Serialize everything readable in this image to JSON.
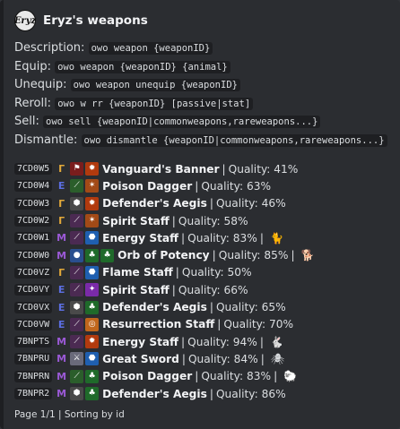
{
  "embed": {
    "author": "Eryz's weapons",
    "avatar_text": "Eryz",
    "commands": [
      {
        "label": "Description:",
        "code": "owo weapon {weaponID}"
      },
      {
        "label": "Equip:",
        "code": "owo weapon {weaponID} {animal}"
      },
      {
        "label": "Unequip:",
        "code": "owo weapon unequip {weaponID}"
      },
      {
        "label": "Reroll:",
        "code": "owo w rr {weaponID} [passive|stat]"
      },
      {
        "label": "Sell:",
        "code": "owo sell {weaponID|commonweapons,rareweapons...}"
      },
      {
        "label": "Dismantle:",
        "code": "owo dismantle {weaponID|commonweapons,rareweapons...}"
      }
    ],
    "weapons": [
      {
        "id": "7CD0W5",
        "rank": "common",
        "icons": [
          "banner",
          "fire"
        ],
        "name": "Vanguard's Banner",
        "quality": "Quality: 41%",
        "pet": ""
      },
      {
        "id": "7CD0W4",
        "rank": "uncommon",
        "icons": [
          "dagger",
          "thorns"
        ],
        "name": "Poison Dagger",
        "quality": "Quality: 63%",
        "pet": ""
      },
      {
        "id": "7CD0W3",
        "rank": "common",
        "icons": [
          "shield",
          "fire"
        ],
        "name": "Defender's Aegis",
        "quality": "Quality: 46%",
        "pet": ""
      },
      {
        "id": "7CD0W2",
        "rank": "common",
        "icons": [
          "staff",
          "thorns"
        ],
        "name": "Spirit Staff",
        "quality": "Quality: 58%",
        "pet": ""
      },
      {
        "id": "7CD0W1",
        "rank": "mythic",
        "icons": [
          "staff",
          "shield-blue"
        ],
        "name": "Energy Staff",
        "quality": "Quality: 83%",
        "pet": "cat"
      },
      {
        "id": "7CD0W0",
        "rank": "mythic",
        "icons": [
          "orb",
          "leaf",
          "leaf"
        ],
        "name": "Orb of Potency",
        "quality": "Quality: 85%",
        "pet": "dog"
      },
      {
        "id": "7CD0VZ",
        "rank": "common",
        "icons": [
          "staff",
          "shield-blue"
        ],
        "name": "Flame Staff",
        "quality": "Quality: 50%",
        "pet": ""
      },
      {
        "id": "7CD0VY",
        "rank": "uncommon",
        "icons": [
          "staff",
          "spark"
        ],
        "name": "Spirit Staff",
        "quality": "Quality: 66%",
        "pet": ""
      },
      {
        "id": "7CD0VX",
        "rank": "uncommon",
        "icons": [
          "shield",
          "leaf"
        ],
        "name": "Defender's Aegis",
        "quality": "Quality: 65%",
        "pet": ""
      },
      {
        "id": "7CD0VW",
        "rank": "uncommon",
        "icons": [
          "staff",
          "swirl"
        ],
        "name": "Resurrection Staff",
        "quality": "Quality: 70%",
        "pet": ""
      },
      {
        "id": "7BNPTS",
        "rank": "mythic",
        "icons": [
          "staff",
          "fire"
        ],
        "name": "Energy Staff",
        "quality": "Quality: 94%",
        "pet": "bunny"
      },
      {
        "id": "7BNPRU",
        "rank": "mythic",
        "icons": [
          "sword",
          "shield-blue"
        ],
        "name": "Great Sword",
        "quality": "Quality: 84%",
        "pet": "spider"
      },
      {
        "id": "7BNPRN",
        "rank": "mythic",
        "icons": [
          "dagger",
          "leaf"
        ],
        "name": "Poison Dagger",
        "quality": "Quality: 83%",
        "pet": "sheep"
      },
      {
        "id": "7BNPR2",
        "rank": "mythic",
        "icons": [
          "shield",
          "leaf"
        ],
        "name": "Defender's Aegis",
        "quality": "Quality: 86%",
        "pet": ""
      }
    ],
    "footer": "Page 1/1 | Sorting by id"
  },
  "rank_glyphs": {
    "common": "Γ",
    "uncommon": "Ε",
    "mythic": "M"
  },
  "icon_styles": {
    "banner": {
      "bg": "#7a1d1d",
      "glyph": "⚑"
    },
    "fire": {
      "bg": "#b13a0e",
      "glyph": "✹"
    },
    "dagger": {
      "bg": "#2b5e2b",
      "glyph": "⟋"
    },
    "thorns": {
      "bg": "#a24a17",
      "glyph": "✶"
    },
    "shield": {
      "bg": "#4a4a4a",
      "glyph": "⬢"
    },
    "staff": {
      "bg": "#4b2a52",
      "glyph": "⟋"
    },
    "shield-blue": {
      "bg": "#1f5fb0",
      "glyph": "⬣"
    },
    "orb": {
      "bg": "#2a4f8f",
      "glyph": "●"
    },
    "leaf": {
      "bg": "#1f6a2a",
      "glyph": "♣"
    },
    "spark": {
      "bg": "#7a2aa8",
      "glyph": "✦"
    },
    "swirl": {
      "bg": "#c0661c",
      "glyph": "◎"
    },
    "sword": {
      "bg": "#6a6a7a",
      "glyph": "⚔"
    }
  },
  "pet_glyphs": {
    "cat": "🐈",
    "dog": "🐕",
    "bunny": "🐇",
    "spider": "🕷",
    "sheep": "🐑"
  },
  "separator": "|"
}
